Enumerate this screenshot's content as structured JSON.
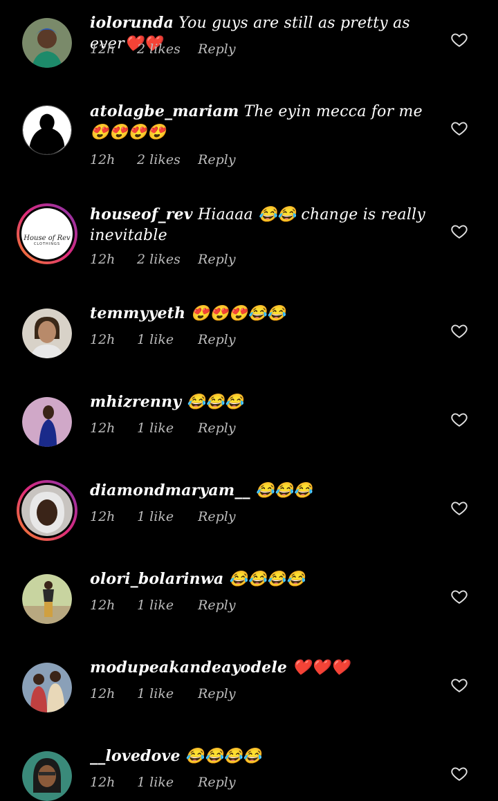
{
  "colors": {
    "background": "#000000",
    "text": "#ffffff",
    "meta": "#bdbdbd",
    "story_ring_start": "#f58529",
    "story_ring_end": "#8134af"
  },
  "comments": [
    {
      "username": "iolorunda",
      "text": "You guys are still as pretty as ever❤️❤️",
      "time": "12h",
      "likes": "2 likes",
      "reply": "Reply",
      "avatar_icon": "avatar-photo-woman-headwrap",
      "has_story": false
    },
    {
      "username": "atolagbe_mariam",
      "text": "The eyin mecca for me😍😍😍😍",
      "time": "12h",
      "likes": "2 likes",
      "reply": "Reply",
      "avatar_icon": "avatar-silhouette",
      "has_story": false
    },
    {
      "username": "houseof_rev",
      "text": "Hiaaaa 😂😂 change is really inevitable",
      "time": "12h",
      "likes": "2 likes",
      "reply": "Reply",
      "avatar_icon": "avatar-brand-logo",
      "avatar_text": "House of Rev",
      "avatar_subtext": "CLOTHINGS",
      "has_story": true
    },
    {
      "username": "temmyyeth",
      "text": "😍😍😍😂😂",
      "time": "12h",
      "likes": "1 like",
      "reply": "Reply",
      "avatar_icon": "avatar-photo-woman",
      "has_story": false
    },
    {
      "username": "mhizrenny",
      "text": "😂😂😂",
      "time": "12h",
      "likes": "1 like",
      "reply": "Reply",
      "avatar_icon": "avatar-photo-blue-dress",
      "has_story": false
    },
    {
      "username": "diamondmaryam__",
      "text": "😂😂😂",
      "time": "12h",
      "likes": "1 like",
      "reply": "Reply",
      "avatar_icon": "avatar-photo-woman-scarf",
      "has_story": true
    },
    {
      "username": "olori_bolarinwa",
      "text": "😂😂😂😂",
      "time": "12h",
      "likes": "1 like",
      "reply": "Reply",
      "avatar_icon": "avatar-photo-outdoor",
      "has_story": false
    },
    {
      "username": "modupeakandeayodele",
      "text": "❤️❤️❤️",
      "time": "12h",
      "likes": "1 like",
      "reply": "Reply",
      "avatar_icon": "avatar-photo-couple",
      "has_story": false
    },
    {
      "username": "__lovedove",
      "text": "😂😂😂😂",
      "time": "12h",
      "likes": "1 like",
      "reply": "Reply",
      "avatar_icon": "avatar-photo-woman-glasses",
      "has_story": false
    }
  ]
}
